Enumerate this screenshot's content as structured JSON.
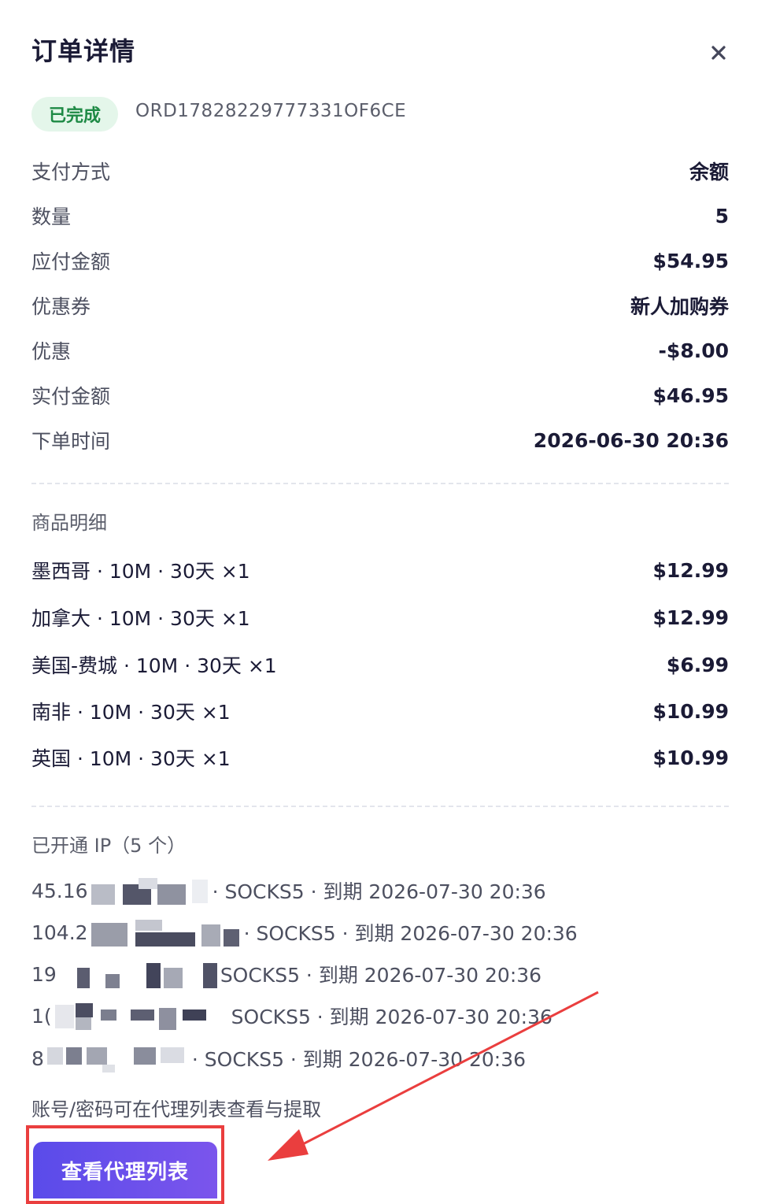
{
  "modal": {
    "title": "订单详情",
    "close_icon": "close-icon"
  },
  "order": {
    "status": "已完成",
    "status_color": "#1e8a45",
    "order_id": "ORD17828229777331OF6CE"
  },
  "summary": [
    {
      "label": "支付方式",
      "value": "余额"
    },
    {
      "label": "数量",
      "value": "5"
    },
    {
      "label": "应付金额",
      "value": "$54.95"
    },
    {
      "label": "优惠券",
      "value": "新人加购券"
    },
    {
      "label": "优惠",
      "value": "-$8.00"
    },
    {
      "label": "实付金额",
      "value": "$46.95"
    },
    {
      "label": "下单时间",
      "value": "2026-06-30 20:36"
    }
  ],
  "items_section": {
    "title": "商品明细",
    "items": [
      {
        "name": "墨西哥 · 10M · 30天 ×1",
        "price": "$12.99"
      },
      {
        "name": "加拿大 · 10M · 30天 ×1",
        "price": "$12.99"
      },
      {
        "name": "美国-费城 · 10M · 30天 ×1",
        "price": "$6.99"
      },
      {
        "name": "南非 · 10M · 30天 ×1",
        "price": "$10.99"
      },
      {
        "name": "英国 · 10M · 30天 ×1",
        "price": "$10.99"
      }
    ]
  },
  "ip_section": {
    "title": "已开通 IP（5 个）",
    "ips": [
      {
        "prefix": "45.16",
        "suffix": "· SOCKS5 · 到期 2026-07-30 20:36"
      },
      {
        "prefix": "104.2",
        "suffix": "· SOCKS5 · 到期 2026-07-30 20:36"
      },
      {
        "prefix": "19",
        "suffix": "SOCKS5 · 到期 2026-07-30 20:36"
      },
      {
        "prefix": "1(",
        "suffix": "SOCKS5 · 到期 2026-07-30 20:36"
      },
      {
        "prefix": "8",
        "suffix": "· SOCKS5 · 到期 2026-07-30 20:36"
      }
    ],
    "note": "账号/密码可在代理列表查看与提取"
  },
  "actions": {
    "view_proxy_list": "查看代理列表"
  },
  "colors": {
    "accent": "#5a4bea",
    "annotation": "#ea3e3e"
  }
}
